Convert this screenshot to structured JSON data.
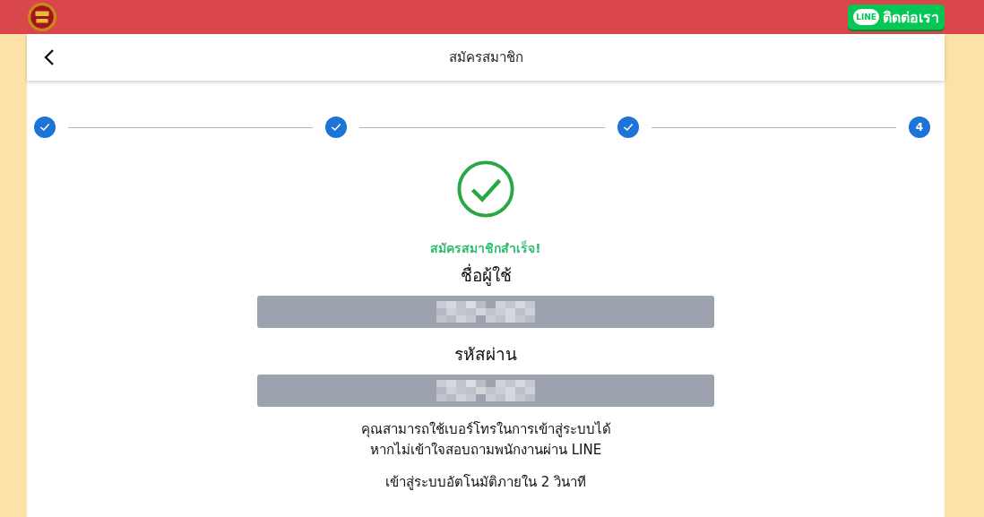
{
  "top_bar": {
    "contact_button": {
      "icon_text": "LINE",
      "label": "ติดต่อเรา"
    }
  },
  "header": {
    "title": "สมัครสมาชิก"
  },
  "steps": [
    {
      "completed": true
    },
    {
      "completed": true
    },
    {
      "completed": true
    },
    {
      "completed": false,
      "label": "4"
    }
  ],
  "result": {
    "message": "สมัครสมาชิกสำเร็จ!"
  },
  "fields": [
    {
      "label": "ชื่อผู้ใช้"
    },
    {
      "label": "รหัสผ่าน"
    }
  ],
  "notes": [
    "คุณสามารถใช้เบอร์โทรในการเข้าสู่ระบบได้",
    "หากไม่เข้าใจสอบถามพนักงานผ่าน LINE"
  ],
  "redirect_note": "เข้าสู่ระบบอัตโนมัติภายใน 2 วินาที"
}
